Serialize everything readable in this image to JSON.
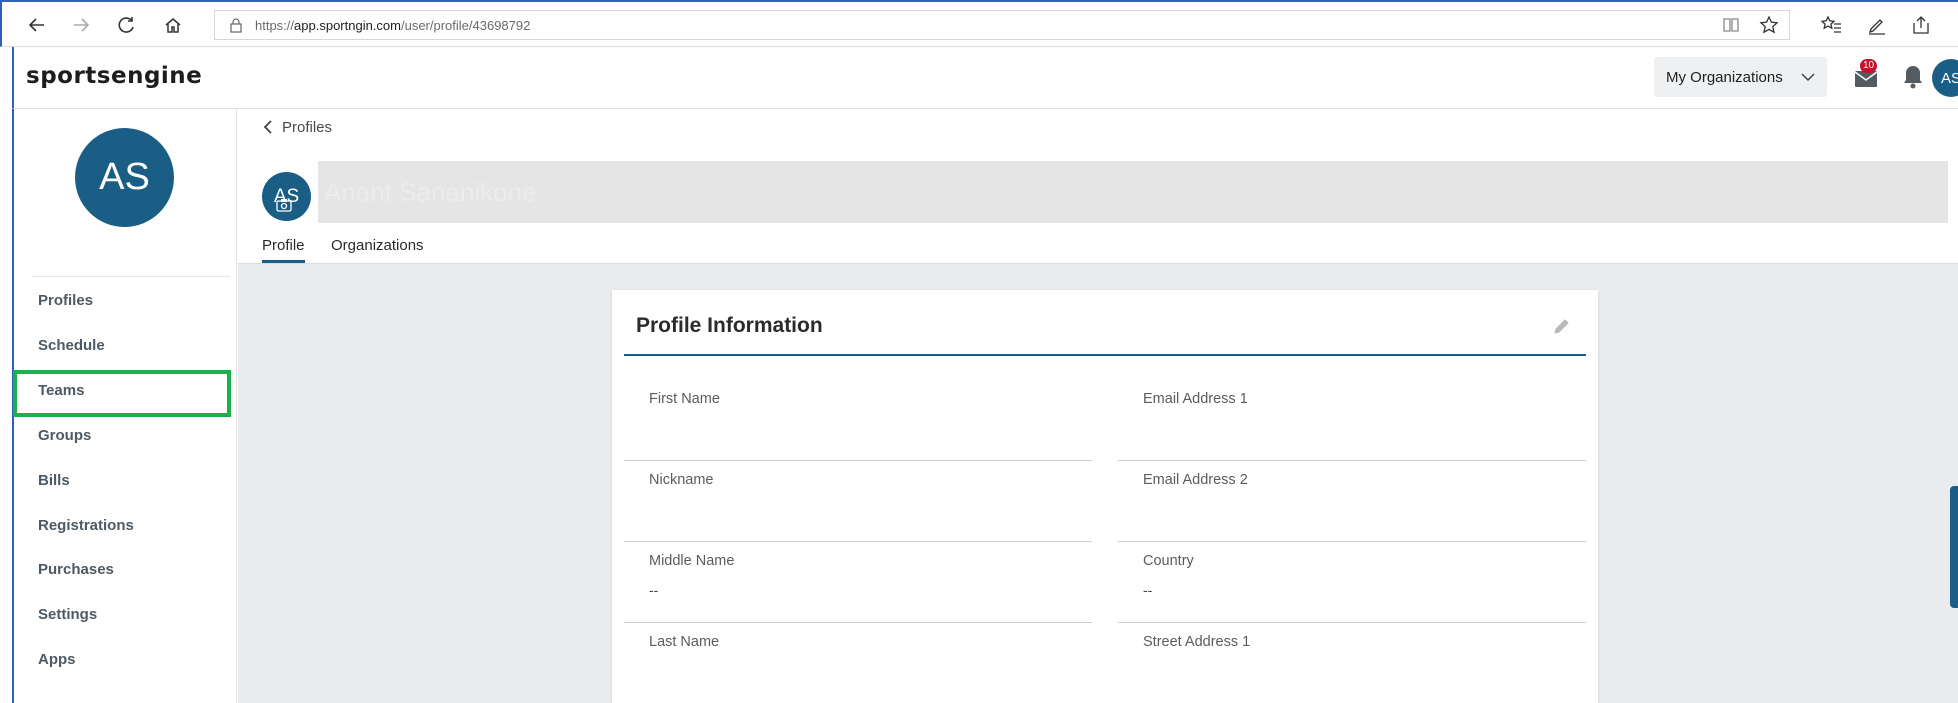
{
  "browser": {
    "url_prefix": "https://",
    "url_host": "app.sportngin.com",
    "url_path": "/user/profile/43698792"
  },
  "header": {
    "logo_text": "sportsengine",
    "orgs_dropdown_label": "My Organizations",
    "mail_badge_count": "10",
    "user_initials": "AS"
  },
  "sidebar": {
    "avatar_initials": "AS",
    "items": [
      {
        "label": "Profiles"
      },
      {
        "label": "Schedule"
      },
      {
        "label": "Teams"
      },
      {
        "label": "Groups"
      },
      {
        "label": "Bills"
      },
      {
        "label": "Registrations"
      },
      {
        "label": "Purchases"
      },
      {
        "label": "Settings"
      },
      {
        "label": "Apps"
      }
    ],
    "highlight_color": "#1ab04c"
  },
  "profile": {
    "back_label": "Profiles",
    "avatar_initials": "AS",
    "name": "Anant Sananikone",
    "tabs": [
      {
        "label": "Profile",
        "active": true
      },
      {
        "label": "Organizations",
        "active": false
      }
    ]
  },
  "card": {
    "title": "Profile Information",
    "fields": [
      {
        "label": "First Name",
        "value": ""
      },
      {
        "label": "Email Address 1",
        "value": ""
      },
      {
        "label": "Nickname",
        "value": ""
      },
      {
        "label": "Email Address 2",
        "value": ""
      },
      {
        "label": "Middle Name",
        "value": "--"
      },
      {
        "label": "Country",
        "value": "--"
      },
      {
        "label": "Last Name",
        "value": ""
      },
      {
        "label": "Street Address 1",
        "value": ""
      }
    ]
  },
  "colors": {
    "brand": "#1a5e86",
    "badge": "#c8102e"
  }
}
